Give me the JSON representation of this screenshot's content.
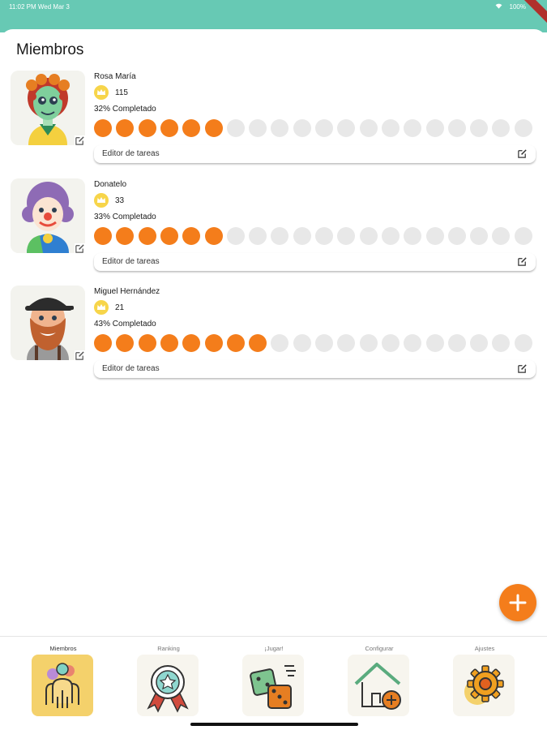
{
  "status_bar": {
    "time": "11:02 PM  Wed Mar 3",
    "battery": "100%"
  },
  "page": {
    "title": "Miembros"
  },
  "members": [
    {
      "name": "Rosa María",
      "points": "115",
      "completed": "32% Completado",
      "progress_total": 20,
      "progress_filled": 6,
      "task_editor_label": "Editor de tareas",
      "avatar_icon": "woman-with-curlers-avatar-icon"
    },
    {
      "name": "Donatelo",
      "points": "33",
      "completed": "33% Completado",
      "progress_total": 20,
      "progress_filled": 6,
      "task_editor_label": "Editor de tareas",
      "avatar_icon": "clown-avatar-icon"
    },
    {
      "name": "Miguel Hernández",
      "points": "21",
      "completed": "43% Completado",
      "progress_total": 20,
      "progress_filled": 8,
      "task_editor_label": "Editor de tareas",
      "avatar_icon": "bearded-man-avatar-icon"
    }
  ],
  "fab": {
    "icon": "plus-icon"
  },
  "bottom_nav": {
    "items": [
      {
        "label": "Miembros",
        "icon": "people-icon",
        "active": true
      },
      {
        "label": "Ranking",
        "icon": "medal-icon",
        "active": false
      },
      {
        "label": "¡Jugar!",
        "icon": "dice-icon",
        "active": false
      },
      {
        "label": "Configurar",
        "icon": "house-add-icon",
        "active": false
      },
      {
        "label": "Ajustes",
        "icon": "gear-icon",
        "active": false
      }
    ]
  },
  "colors": {
    "header": "#67c9b4",
    "accent": "#f47d1b",
    "empty_dot": "#e8e8e8",
    "active_tab": "#f4d16b"
  }
}
